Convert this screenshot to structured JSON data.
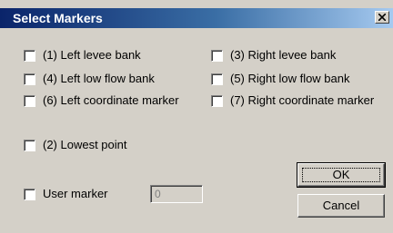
{
  "window": {
    "title": "Select Markers"
  },
  "checkboxes": {
    "left_levee": "(1) Left levee bank",
    "right_levee": "(3) Right levee bank",
    "left_low_flow": "(4) Left low flow bank",
    "right_low_flow": "(5) Right low flow bank",
    "left_coord": "(6) Left coordinate marker",
    "right_coord": "(7) Right coordinate marker",
    "lowest_point": "(2) Lowest point",
    "user_marker": "User marker"
  },
  "user_marker_value": "0",
  "buttons": {
    "ok": "OK",
    "cancel": "Cancel"
  }
}
